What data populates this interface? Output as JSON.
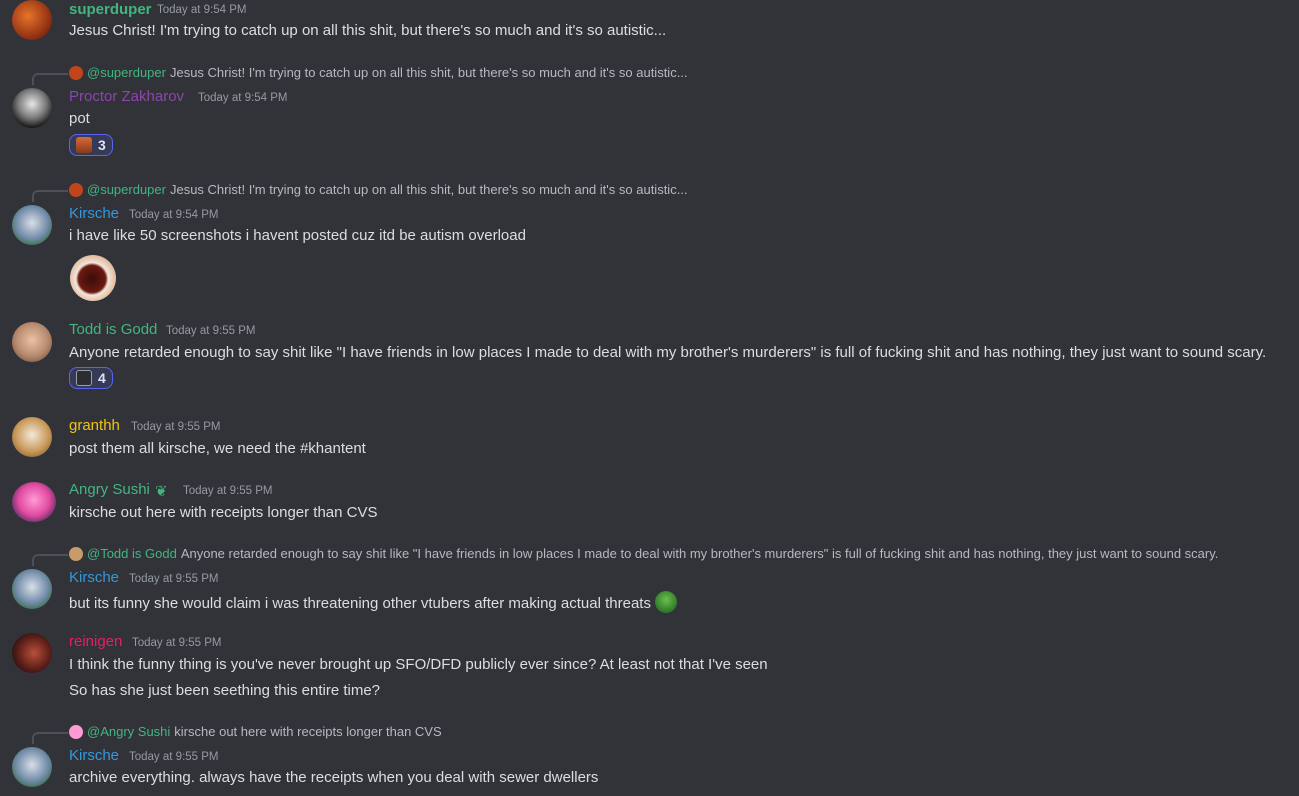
{
  "colors": {
    "background": "#313338",
    "green": "#43b581",
    "purple": "#8e44ad",
    "blue": "#3498db",
    "yellow": "#f1c40f",
    "pink": "#e91e63",
    "accent": "#5865f2"
  },
  "messages": [
    {
      "author": "superduper",
      "timestamp": "Today at 9:54 PM",
      "lines": [
        "Jesus Christ!  I'm trying to catch up on all this shit, but there's so much and it's so autistic..."
      ]
    },
    {
      "reply": {
        "mention": "@superduper",
        "text": "Jesus Christ! I'm trying to catch up on all this shit, but there's so much and it's so autistic..."
      },
      "author": "Proctor Zakharov",
      "timestamp": "Today at 9:54 PM",
      "lines": [
        "pot"
      ],
      "reaction": {
        "icon": "face-emoji",
        "count": "3"
      }
    },
    {
      "reply": {
        "mention": "@superduper",
        "text": "Jesus Christ! I'm trying to catch up on all this shit, but there's so much and it's so autistic..."
      },
      "author": "Kirsche",
      "timestamp": "Today at 9:54 PM",
      "lines": [
        "i have like 50 screenshots i havent posted cuz itd be autism overload"
      ],
      "sticker": "open-mouth-sticker"
    },
    {
      "author": "Todd is Godd",
      "timestamp": "Today at 9:55 PM",
      "lines": [
        "Anyone retarded enough to say shit like \"I have friends in low places I made to deal with my brother's murderers\" is full of fucking shit and has nothing, they just want to sound scary."
      ],
      "reaction": {
        "icon": "gun-emoji",
        "count": "4"
      }
    },
    {
      "author": "granthh",
      "timestamp": "Today at 9:55 PM",
      "lines": [
        "post them all kirsche, we need the #khantent"
      ]
    },
    {
      "author": "Angry Sushi",
      "timestamp": "Today at 9:55 PM",
      "lines": [
        "kirsche out here with receipts longer than CVS"
      ]
    },
    {
      "reply": {
        "mention": "@Todd is Godd",
        "text": "Anyone retarded enough to say shit like \"I have friends in low places I made to deal with my brother's murderers\" is full of fucking shit and has nothing, they just want to sound scary."
      },
      "author": "Kirsche",
      "timestamp": "Today at 9:55 PM",
      "lines": [
        "but its funny she would claim i was threatening other vtubers after making actual threats"
      ]
    },
    {
      "author": "reinigen",
      "timestamp": "Today at 9:55 PM",
      "lines": [
        "I think the funny thing is you've never brought up SFO/DFD publicly ever since? At least not that I've seen",
        "So has she just been seething this entire time?"
      ]
    },
    {
      "reply": {
        "mention": "@Angry Sushi",
        "text": "kirsche out here with receipts longer than CVS"
      },
      "author": "Kirsche",
      "timestamp": "Today at 9:55 PM",
      "lines": [
        "archive everything. always have the receipts when you deal with sewer dwellers"
      ]
    }
  ]
}
